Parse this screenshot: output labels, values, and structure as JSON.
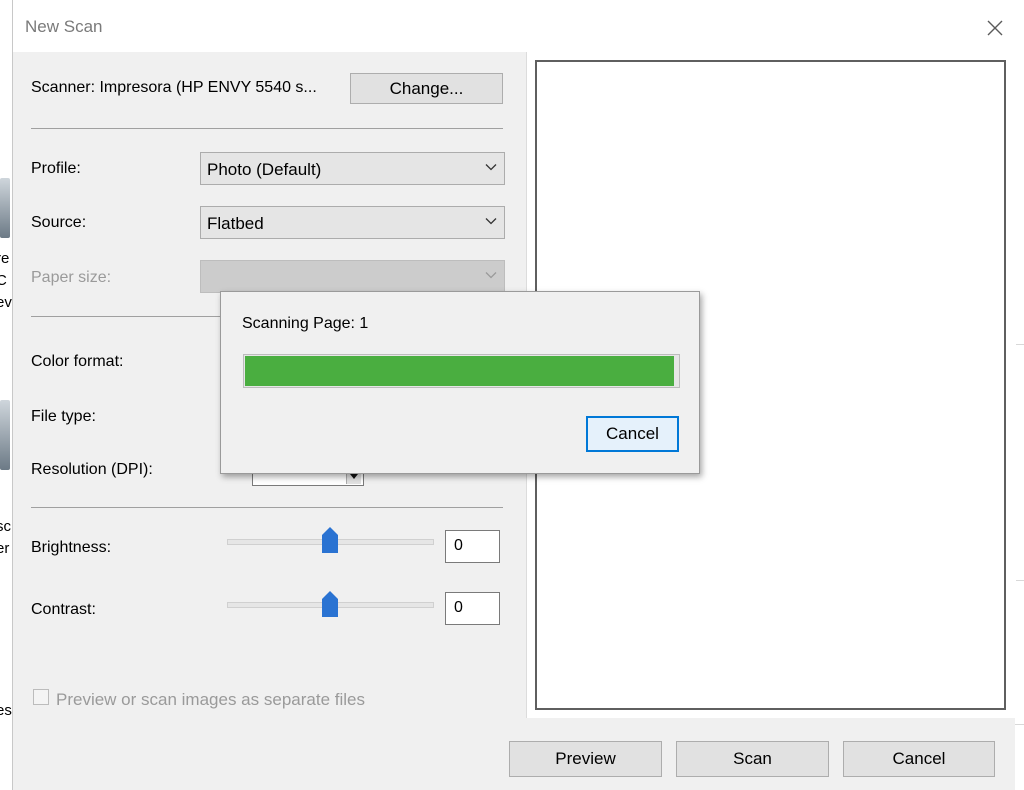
{
  "window": {
    "title": "New Scan"
  },
  "scanner": {
    "label": "Scanner: Impresora (HP ENVY 5540 s...",
    "change_button": "Change..."
  },
  "profile": {
    "label": "Profile:",
    "value": "Photo (Default)"
  },
  "source": {
    "label": "Source:",
    "value": "Flatbed"
  },
  "paper_size": {
    "label": "Paper size:",
    "value": ""
  },
  "color_format": {
    "label": "Color format:"
  },
  "file_type": {
    "label": "File type:"
  },
  "resolution": {
    "label": "Resolution (DPI):"
  },
  "brightness": {
    "label": "Brightness:",
    "value": "0",
    "level": 0.5
  },
  "contrast": {
    "label": "Contrast:",
    "value": "0",
    "level": 0.5
  },
  "separate_files": {
    "label": "Preview or scan images as separate files",
    "checked": false
  },
  "buttons": {
    "preview": "Preview",
    "scan": "Scan",
    "cancel": "Cancel"
  },
  "progress_dialog": {
    "text": "Scanning Page: 1",
    "progress_percent": 99,
    "cancel": "Cancel"
  },
  "background": {
    "fragments": [
      "re",
      "C",
      "ev",
      "sc",
      "er",
      "es"
    ]
  },
  "colors": {
    "accent": "#0078d7",
    "progress": "#4aae40",
    "slider_thumb": "#2a73d2"
  }
}
